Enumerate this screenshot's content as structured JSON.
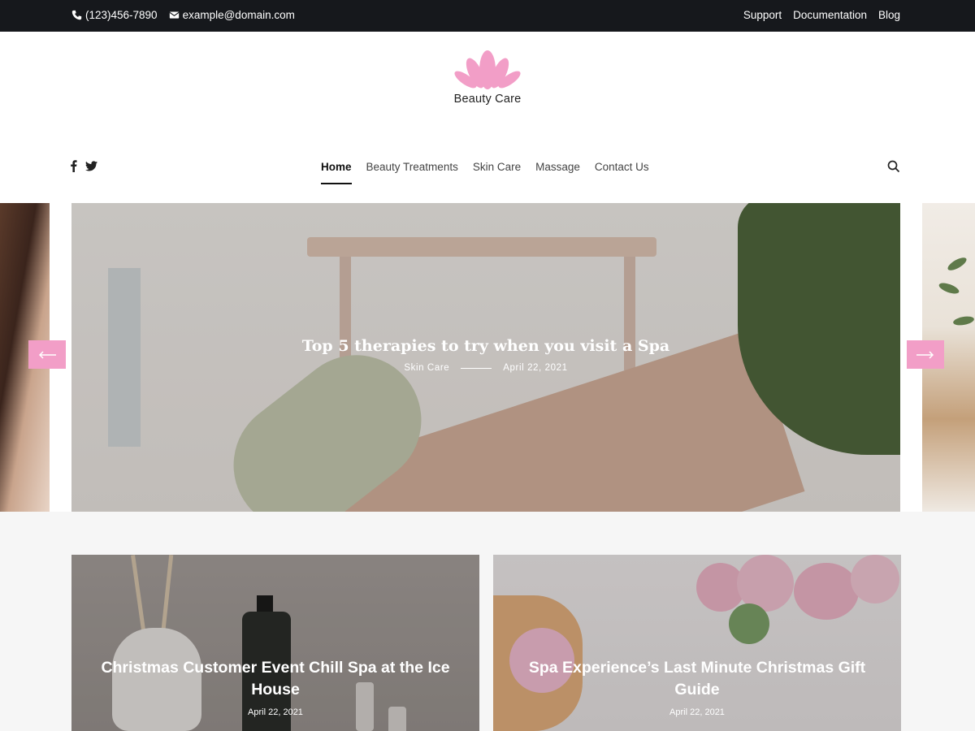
{
  "topbar": {
    "phone": "(123)456-7890",
    "email": "example@domain.com",
    "links": [
      "Support",
      "Documentation",
      "Blog"
    ]
  },
  "logo": {
    "text": "Beauty Care",
    "color": "#f29ec7"
  },
  "social": [
    "facebook-icon",
    "twitter-icon"
  ],
  "nav": {
    "items": [
      "Home",
      "Beauty Treatments",
      "Skin Care",
      "Massage",
      "Contact Us"
    ],
    "active": "Home"
  },
  "hero": {
    "title": "Top 5 therapies to try when you visit a Spa",
    "category": "Skin Care",
    "date": "April 22, 2021",
    "prev_icon": "arrow-left-icon",
    "next_icon": "arrow-right-icon",
    "accent": "#f29ec7"
  },
  "posts": [
    {
      "title": "Christmas Customer Event Chill Spa at the Ice House",
      "date": "April 22, 2021"
    },
    {
      "title": "Spa Experience’s Last Minute Christmas Gift Guide",
      "date": "April 22, 2021"
    }
  ]
}
